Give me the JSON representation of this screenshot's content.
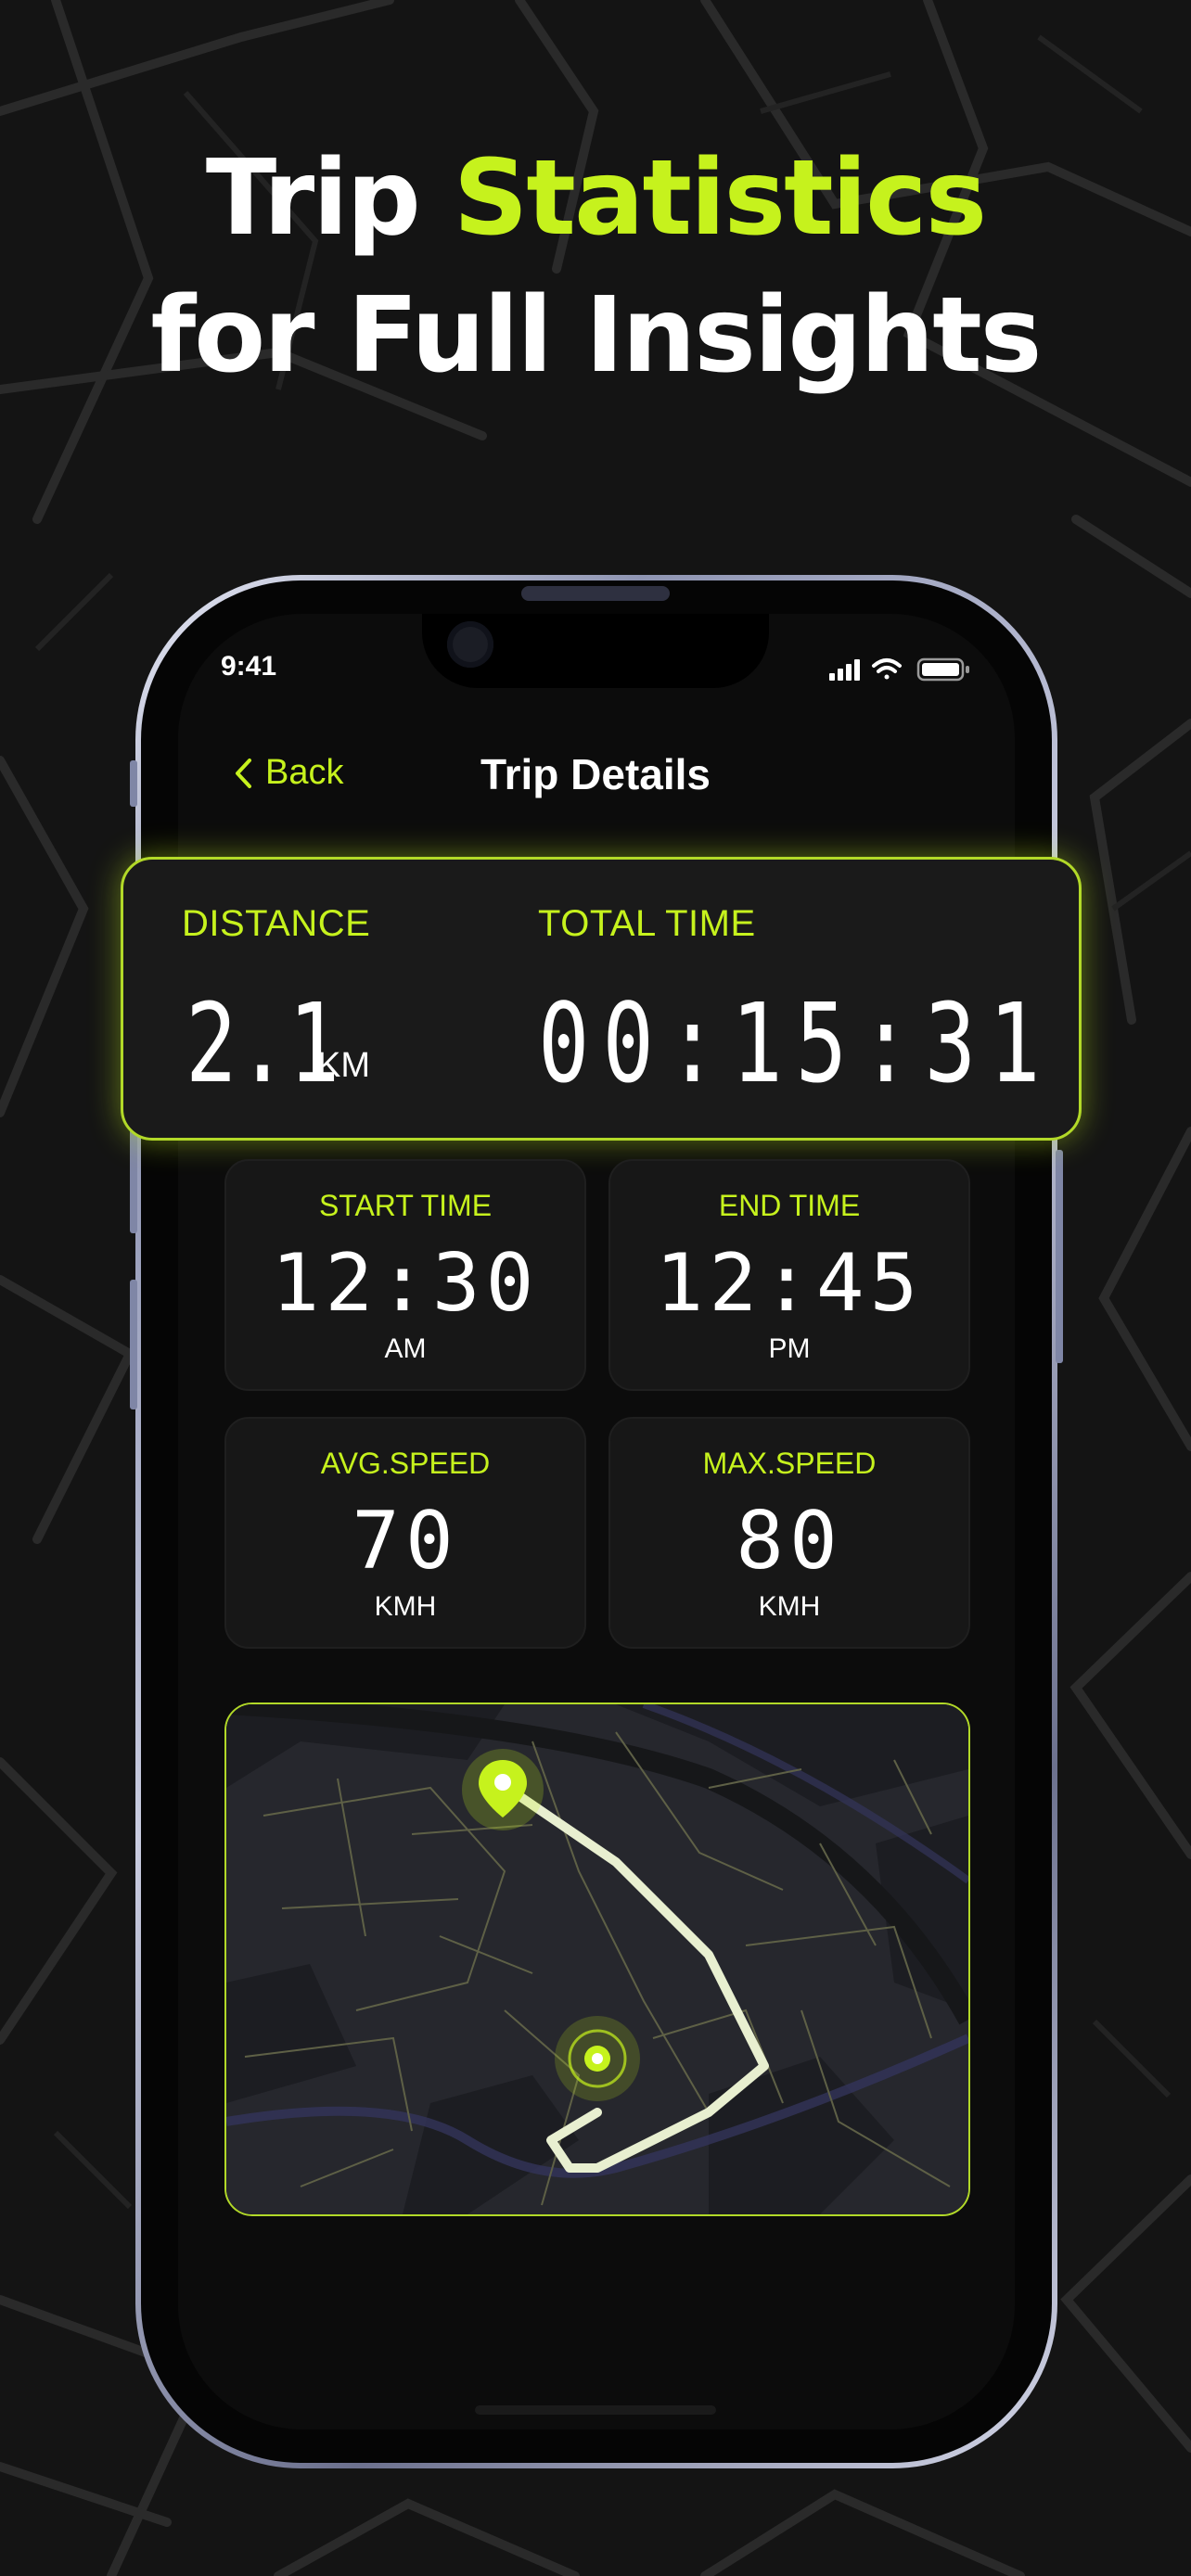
{
  "headline": {
    "line1_white": "Trip ",
    "line1_green": "Statistics",
    "line2": "for Full Insights"
  },
  "colors": {
    "accent": "#c6f21d",
    "background": "#141414",
    "card": "#171717"
  },
  "status_bar": {
    "time": "9:41",
    "icons": [
      "cellular-signal-icon",
      "wifi-icon",
      "battery-icon"
    ]
  },
  "nav": {
    "back_label": "Back",
    "title": "Trip Details"
  },
  "summary": {
    "distance_label": "DISTANCE",
    "distance_value": "2.1",
    "distance_unit": "KM",
    "total_time_label": "TOTAL TIME",
    "total_time_value": "00:15:31"
  },
  "stats": {
    "start_time": {
      "label": "START TIME",
      "value": "12:30",
      "unit": "AM"
    },
    "end_time": {
      "label": "END TIME",
      "value": "12:45",
      "unit": "PM"
    },
    "avg_speed": {
      "label": "AVG.SPEED",
      "value": "70",
      "unit": "KMH"
    },
    "max_speed": {
      "label": "MAX.SPEED",
      "value": "80",
      "unit": "KMH"
    }
  },
  "map": {
    "markers": [
      "start-pin-icon",
      "end-location-icon"
    ]
  }
}
